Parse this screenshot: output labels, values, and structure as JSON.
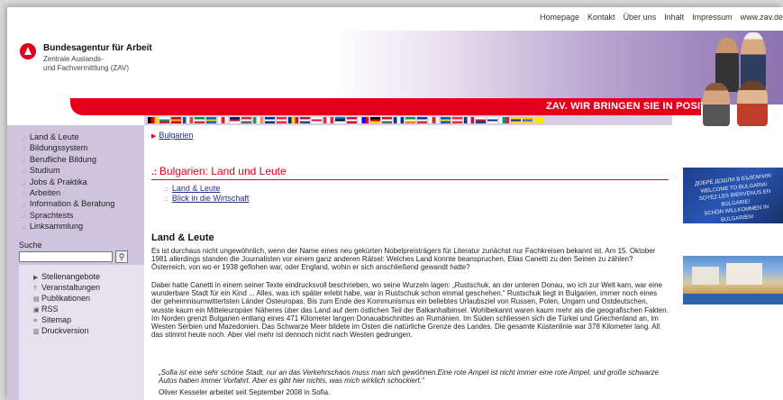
{
  "topnav": [
    "Homepage",
    "Kontakt",
    "Über uns",
    "Inhalt",
    "Impressum",
    "www.zav.de"
  ],
  "logo": {
    "title": "Bundesagentur für Arbeit",
    "subtitle_line1": "Zentrale Auslands-",
    "subtitle_line2": "und Fachvermittlung (ZAV)"
  },
  "banner": {
    "slogan": "ZAV. WIR BRINGEN SIE IN POSITION."
  },
  "colors": {
    "brand_red": "#e2001a",
    "nav_purple": "#cfc4de",
    "link_blue": "#1f2f8a"
  },
  "leftnav": {
    "items": [
      "Land & Leute",
      "Bildungssystem",
      "Berufliche Bildung",
      "Studium",
      "Jobs & Praktika",
      "Arbeiten",
      "Information & Beratung",
      "Sprachtests",
      "Linksammlung"
    ],
    "search_label": "Suche",
    "search_button_icon": "magnifier-icon",
    "extras": [
      {
        "label": "Stellenangebote",
        "icon": "arrow-icon"
      },
      {
        "label": "Veranstaltungen",
        "icon": "event-icon"
      },
      {
        "label": "Publikationen",
        "icon": "publication-icon"
      },
      {
        "label": "RSS",
        "icon": "rss-icon"
      },
      {
        "label": "Sitemap",
        "icon": "sitemap-icon"
      },
      {
        "label": "Druckversion",
        "icon": "print-icon"
      }
    ]
  },
  "breadcrumb": "Bulgarien",
  "main": {
    "heading": "Bulgarien: Land und Leute",
    "sublinks": [
      "Land & Leute",
      "Blick in die Wirtschaft"
    ],
    "section_title": "Land & Leute",
    "para1": "Es ist durchaus nicht ungewöhnlich, wenn der Name eines neu gekürten Nobelpreisträgers für Literatur zunächst nur Fachkreisen bekannt ist. Am 15. Oktober 1981 allerdings standen die Journalisten vor einem ganz anderen Rätsel: Welches Land konnte beanspruchen, Elias Canetti zu den Seinen zu zählen? Österreich, von wo er 1938 geflohen war, oder England, wohin er sich anschließend gewandt hatte?",
    "para2": "Dabei hatte Canetti in einem seiner Texte eindrucksvoll beschrieben, wo seine Wurzeln lagen: „Rustschuk, an der unteren Donau, wo ich zur Welt kam, war eine wunderbare Stadt für ein Kind ... Alles, was ich später erlebt habe, war in Rustschuk schon einmal geschehen.“ Rustschuk liegt in Bulgarien, immer noch eines der geheimnisumwittertsten Länder Osteuropas. Bis zum Ende des Kommunismus ein beliebtes Urlaubsziel von Russen, Polen, Ungarn und Ostdeutschen, wusste kaum ein Mitteleuropäer Näheres über das Land auf dem östlichen Teil der Balkanhalbinsel. Wohlbekannt waren kaum mehr als die geografischen Fakten. Im Norden grenzt Bulgarien entlang eines 471 Kilometer langen Donauabschnittes an Rumänien. Im Süden schliessen sich die Türkei und Griechenland an, im Westen Serbien und Mazedonien. Das Schwarze Meer bildete im Osten die natürliche Grenze des Landes. Die gesamte Küstenlinie war 378 Kilometer lang. All das stimmt heute noch. Aber viel mehr ist dennoch nicht nach Westen gedrungen.",
    "quote": "„Sofia ist eine sehr schöne Stadt, nur an das Verkehrschaos muss man sich gewöhnen.Eine rote Ampel ist nicht immer eine rote Ampel, und große schwarze Autos haben immer Vorfahrt. Aber es gibt hier nichts, was mich wirklich schockiert.“",
    "author": "Oliver Kesseler arbeitet seit September 2008 in Sofia."
  },
  "photo1_sign": [
    "ДОБРЕ ДОШЛИ В БЪЛГАРИЯ!",
    "WELCOME TO BULGARIA!",
    "SOYEZ LES BIENVENUS EN BULGARIE!",
    "SCHÖN WILLKOMMEN IN BULGARIEN!"
  ],
  "flags": [
    [
      "#000",
      "#dd0000",
      "#ffce00"
    ],
    [
      "#ffffff",
      "#00966e",
      "#d62612"
    ],
    [
      "#c60b1e",
      "#ffc400",
      "#c60b1e"
    ],
    [
      "#0055a4",
      "#ffffff",
      "#ef4135"
    ],
    [
      "#009246",
      "#ffffff",
      "#ce2b37"
    ],
    [
      "#006aa7",
      "#fecc00",
      "#006aa7"
    ],
    [
      "#ffffff",
      "#d52b1e",
      "#ffffff"
    ],
    [
      "#012169",
      "#c8102e",
      "#ffffff"
    ],
    [
      "#cd2a3e",
      "#ffffff",
      "#436f4d"
    ],
    [
      "#169b62",
      "#ffffff",
      "#ff883e"
    ],
    [
      "#003580",
      "#ffffff",
      "#003580"
    ],
    [
      "#ed2939",
      "#ffffff",
      "#ed2939"
    ],
    [
      "#002b7f",
      "#fcd116",
      "#ce1126"
    ],
    [
      "#ae1c28",
      "#ffffff",
      "#21468b"
    ],
    [
      "#ffffff",
      "#dc143c",
      "#ffffff"
    ],
    [
      "#ed2939",
      "#ffffff",
      "#ed2939"
    ],
    [
      "#0072ce",
      "#000000",
      "#ffffff"
    ],
    [
      "#c8102e",
      "#ffffff",
      "#c8102e"
    ],
    [
      "#ffffff",
      "#0000ff",
      "#ff0000"
    ],
    [
      "#000000",
      "#dd0000",
      "#ffce00"
    ],
    [
      "#ce1126",
      "#ffffff",
      "#477050"
    ],
    [
      "#003893",
      "#ffffff",
      "#003893"
    ],
    [
      "#009a44",
      "#ffffff",
      "#ff8200"
    ],
    [
      "#0039a6",
      "#ffffff",
      "#d52b1e"
    ],
    [
      "#ffffff",
      "#d52b1e",
      "#ffffff"
    ],
    [
      "#005bbb",
      "#ffd500",
      "#005bbb"
    ],
    [
      "#ed2939",
      "#ffffff",
      "#ed2939"
    ],
    [
      "#0032a0",
      "#ffffff",
      "#c8102e"
    ],
    [
      "#ffffff",
      "#d7141a",
      "#11457e"
    ],
    [
      "#ffffff",
      "#003399",
      "#ffffff"
    ],
    [
      "#ffffff",
      "#00966e",
      "#d62612"
    ],
    [
      "#ffd700",
      "#003399",
      "#ffd700"
    ],
    [
      "#ffcc00",
      "#3366cc",
      "#ffcc00"
    ],
    [
      "#ffe600",
      "#ffe600",
      "#ffe600"
    ]
  ]
}
